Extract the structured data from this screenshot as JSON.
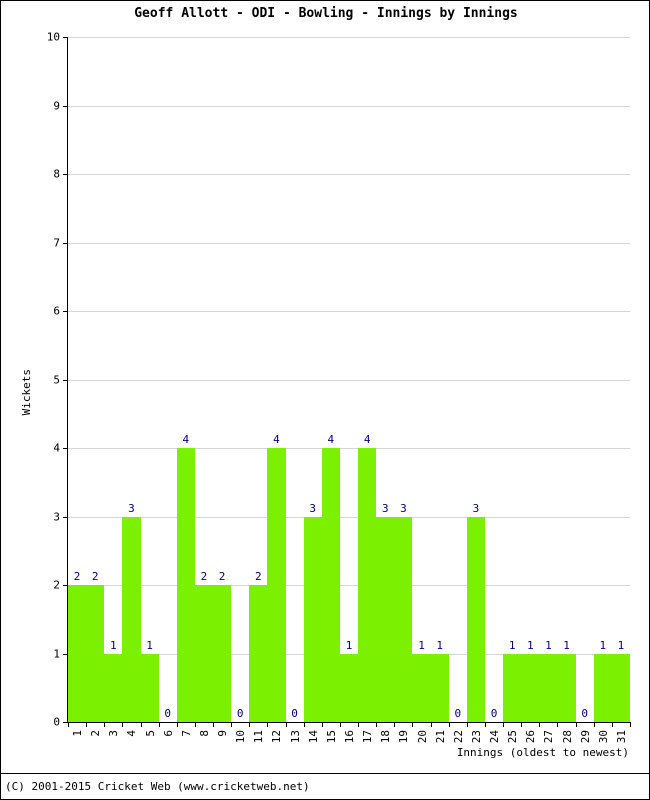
{
  "chart_data": {
    "type": "bar",
    "title": "Geoff Allott - ODI - Bowling - Innings by Innings",
    "xlabel": "Innings (oldest to newest)",
    "ylabel": "Wickets",
    "ylim": [
      0,
      10
    ],
    "ytick_labels": [
      "0",
      "1",
      "2",
      "3",
      "4",
      "5",
      "6",
      "7",
      "8",
      "9",
      "10"
    ],
    "ytick_values": [
      0,
      1,
      2,
      3,
      4,
      5,
      6,
      7,
      8,
      9,
      10
    ],
    "grid": true,
    "legend": "none",
    "bar_color": "#7CF001",
    "label_color": "#00007F",
    "categories": [
      "1",
      "2",
      "3",
      "4",
      "5",
      "6",
      "7",
      "8",
      "9",
      "10",
      "11",
      "12",
      "13",
      "14",
      "15",
      "16",
      "17",
      "18",
      "19",
      "20",
      "21",
      "22",
      "23",
      "24",
      "25",
      "26",
      "27",
      "28",
      "29",
      "30",
      "31"
    ],
    "values": [
      2,
      2,
      1,
      3,
      1,
      0,
      4,
      2,
      2,
      0,
      2,
      4,
      0,
      3,
      4,
      1,
      4,
      3,
      3,
      1,
      1,
      0,
      3,
      0,
      1,
      1,
      1,
      1,
      0,
      1,
      1
    ],
    "point_labels": [
      "2",
      "2",
      "1",
      "3",
      "1",
      "0",
      "4",
      "2",
      "2",
      "0",
      "2",
      "4",
      "0",
      "3",
      "4",
      "1",
      "4",
      "3",
      "3",
      "1",
      "1",
      "0",
      "3",
      "0",
      "1",
      "1",
      "1",
      "1",
      "0",
      "1",
      "1"
    ]
  },
  "footer": {
    "copyright": "(C) 2001-2015 Cricket Web (www.cricketweb.net)"
  }
}
